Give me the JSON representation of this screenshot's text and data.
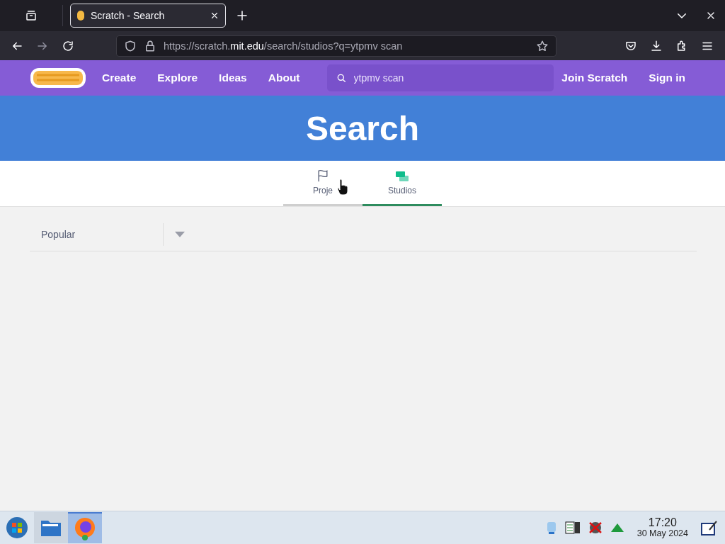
{
  "browser": {
    "tab_title": "Scratch - Search",
    "url": "https://scratch.**mit.edu**/search/studios?q=ytpmv scan"
  },
  "nav": {
    "links": [
      "Create",
      "Explore",
      "Ideas",
      "About"
    ],
    "search": {
      "value": "ytpmv scan"
    },
    "actions": [
      "Join Scratch",
      "Sign in"
    ]
  },
  "banner": {
    "title": "Search"
  },
  "tabs": [
    {
      "label": "Proje",
      "selected": false,
      "kind": "projects"
    },
    {
      "label": "Studios",
      "selected": true,
      "kind": "studios"
    }
  ],
  "filter": {
    "value": "Popular"
  },
  "taskbar": {
    "time": "17:20",
    "date": "30 May 2024"
  }
}
